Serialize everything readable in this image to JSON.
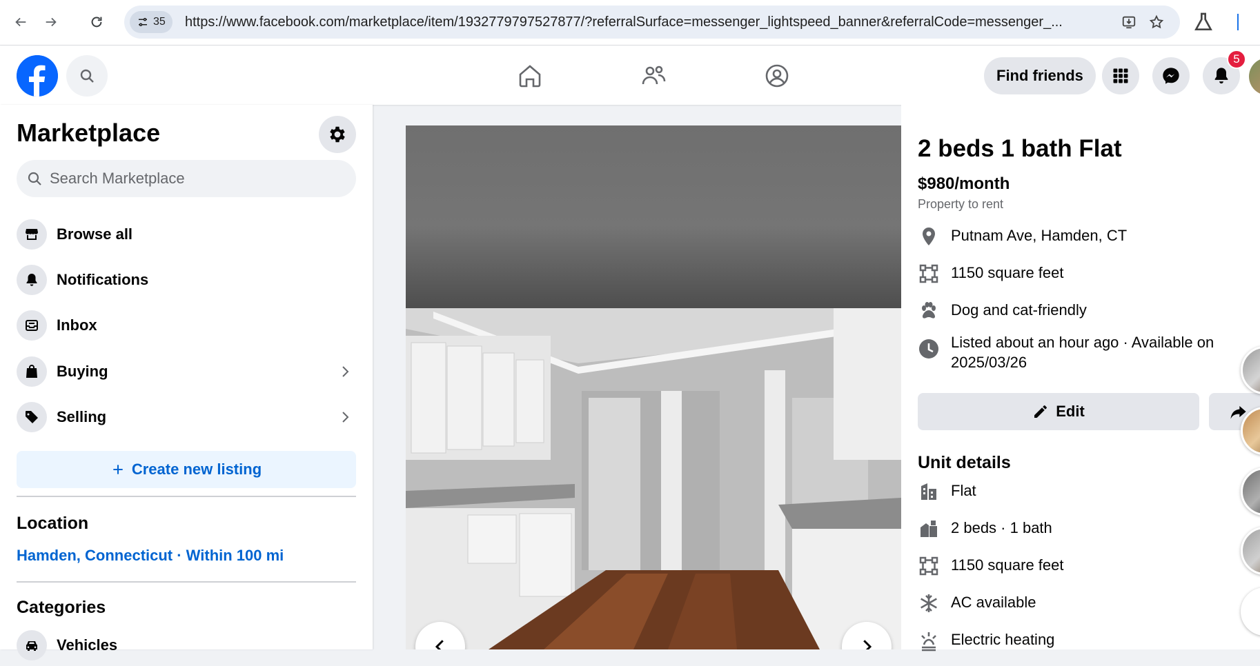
{
  "browser": {
    "tab_count": "35",
    "url": "https://www.facebook.com/marketplace/item/1932779797527877/?referralSurface=messenger_lightspeed_banner&referralCode=messenger_..."
  },
  "topbar": {
    "find_friends_label": "Find friends",
    "notification_count": "5"
  },
  "sidebar": {
    "title": "Marketplace",
    "search_placeholder": "Search Marketplace",
    "items": [
      {
        "label": "Browse all",
        "icon": "storefront-icon"
      },
      {
        "label": "Notifications",
        "icon": "bell-icon"
      },
      {
        "label": "Inbox",
        "icon": "inbox-icon"
      },
      {
        "label": "Buying",
        "icon": "shopping-bag-icon"
      },
      {
        "label": "Selling",
        "icon": "tag-icon"
      }
    ],
    "create_listing_label": "Create new listing",
    "location_heading": "Location",
    "location_value": "Hamden, Connecticut · Within 100 mi",
    "categories_heading": "Categories",
    "first_category": "Vehicles"
  },
  "listing": {
    "title": "2 beds 1 bath Flat",
    "price": "$980/month",
    "subtitle": "Property to rent",
    "facts": [
      {
        "icon": "location-pin-icon",
        "text": "Putnam Ave, Hamden, CT"
      },
      {
        "icon": "area-icon",
        "text": "1150 square feet"
      },
      {
        "icon": "paw-icon",
        "text": "Dog and cat-friendly"
      },
      {
        "icon": "clock-icon",
        "text": "Listed about an hour ago · Available on 2025/03/26"
      }
    ],
    "edit_label": "Edit",
    "unit_details_heading": "Unit details",
    "unit_details": [
      {
        "icon": "building-icon",
        "text": "Flat"
      },
      {
        "icon": "rooms-icon",
        "text": "2 beds · 1 bath"
      },
      {
        "icon": "area-icon",
        "text": "1150 square feet"
      },
      {
        "icon": "snowflake-icon",
        "text": "AC available"
      },
      {
        "icon": "heating-icon",
        "text": "Electric heating"
      }
    ]
  },
  "colors": {
    "fb_blue": "#0866ff",
    "link_blue": "#0064d1",
    "badge_red": "#e41e3f"
  }
}
